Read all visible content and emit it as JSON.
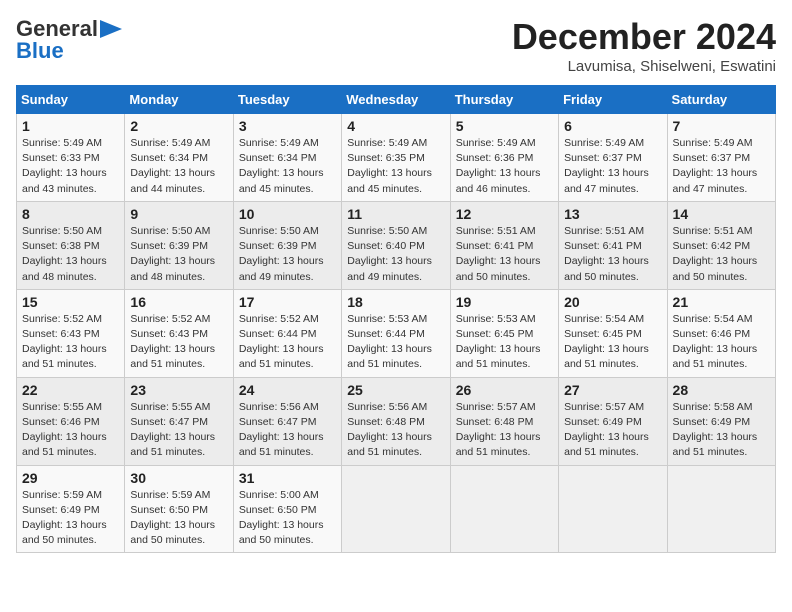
{
  "header": {
    "logo_line1": "General",
    "logo_line2": "Blue",
    "month": "December 2024",
    "location": "Lavumisa, Shiselweni, Eswatini"
  },
  "days_of_week": [
    "Sunday",
    "Monday",
    "Tuesday",
    "Wednesday",
    "Thursday",
    "Friday",
    "Saturday"
  ],
  "weeks": [
    [
      {
        "day": 1,
        "rise": "5:49 AM",
        "set": "6:33 PM",
        "daylight": "13 hours and 43 minutes"
      },
      {
        "day": 2,
        "rise": "5:49 AM",
        "set": "6:34 PM",
        "daylight": "13 hours and 44 minutes"
      },
      {
        "day": 3,
        "rise": "5:49 AM",
        "set": "6:34 PM",
        "daylight": "13 hours and 45 minutes"
      },
      {
        "day": 4,
        "rise": "5:49 AM",
        "set": "6:35 PM",
        "daylight": "13 hours and 45 minutes"
      },
      {
        "day": 5,
        "rise": "5:49 AM",
        "set": "6:36 PM",
        "daylight": "13 hours and 46 minutes"
      },
      {
        "day": 6,
        "rise": "5:49 AM",
        "set": "6:37 PM",
        "daylight": "13 hours and 47 minutes"
      },
      {
        "day": 7,
        "rise": "5:49 AM",
        "set": "6:37 PM",
        "daylight": "13 hours and 47 minutes"
      }
    ],
    [
      {
        "day": 8,
        "rise": "5:50 AM",
        "set": "6:38 PM",
        "daylight": "13 hours and 48 minutes"
      },
      {
        "day": 9,
        "rise": "5:50 AM",
        "set": "6:39 PM",
        "daylight": "13 hours and 48 minutes"
      },
      {
        "day": 10,
        "rise": "5:50 AM",
        "set": "6:39 PM",
        "daylight": "13 hours and 49 minutes"
      },
      {
        "day": 11,
        "rise": "5:50 AM",
        "set": "6:40 PM",
        "daylight": "13 hours and 49 minutes"
      },
      {
        "day": 12,
        "rise": "5:51 AM",
        "set": "6:41 PM",
        "daylight": "13 hours and 50 minutes"
      },
      {
        "day": 13,
        "rise": "5:51 AM",
        "set": "6:41 PM",
        "daylight": "13 hours and 50 minutes"
      },
      {
        "day": 14,
        "rise": "5:51 AM",
        "set": "6:42 PM",
        "daylight": "13 hours and 50 minutes"
      }
    ],
    [
      {
        "day": 15,
        "rise": "5:52 AM",
        "set": "6:43 PM",
        "daylight": "13 hours and 51 minutes"
      },
      {
        "day": 16,
        "rise": "5:52 AM",
        "set": "6:43 PM",
        "daylight": "13 hours and 51 minutes"
      },
      {
        "day": 17,
        "rise": "5:52 AM",
        "set": "6:44 PM",
        "daylight": "13 hours and 51 minutes"
      },
      {
        "day": 18,
        "rise": "5:53 AM",
        "set": "6:44 PM",
        "daylight": "13 hours and 51 minutes"
      },
      {
        "day": 19,
        "rise": "5:53 AM",
        "set": "6:45 PM",
        "daylight": "13 hours and 51 minutes"
      },
      {
        "day": 20,
        "rise": "5:54 AM",
        "set": "6:45 PM",
        "daylight": "13 hours and 51 minutes"
      },
      {
        "day": 21,
        "rise": "5:54 AM",
        "set": "6:46 PM",
        "daylight": "13 hours and 51 minutes"
      }
    ],
    [
      {
        "day": 22,
        "rise": "5:55 AM",
        "set": "6:46 PM",
        "daylight": "13 hours and 51 minutes"
      },
      {
        "day": 23,
        "rise": "5:55 AM",
        "set": "6:47 PM",
        "daylight": "13 hours and 51 minutes"
      },
      {
        "day": 24,
        "rise": "5:56 AM",
        "set": "6:47 PM",
        "daylight": "13 hours and 51 minutes"
      },
      {
        "day": 25,
        "rise": "5:56 AM",
        "set": "6:48 PM",
        "daylight": "13 hours and 51 minutes"
      },
      {
        "day": 26,
        "rise": "5:57 AM",
        "set": "6:48 PM",
        "daylight": "13 hours and 51 minutes"
      },
      {
        "day": 27,
        "rise": "5:57 AM",
        "set": "6:49 PM",
        "daylight": "13 hours and 51 minutes"
      },
      {
        "day": 28,
        "rise": "5:58 AM",
        "set": "6:49 PM",
        "daylight": "13 hours and 51 minutes"
      }
    ],
    [
      {
        "day": 29,
        "rise": "5:59 AM",
        "set": "6:49 PM",
        "daylight": "13 hours and 50 minutes"
      },
      {
        "day": 30,
        "rise": "5:59 AM",
        "set": "6:50 PM",
        "daylight": "13 hours and 50 minutes"
      },
      {
        "day": 31,
        "rise": "5:00 AM",
        "set": "6:50 PM",
        "daylight": "13 hours and 50 minutes"
      },
      null,
      null,
      null,
      null
    ]
  ]
}
